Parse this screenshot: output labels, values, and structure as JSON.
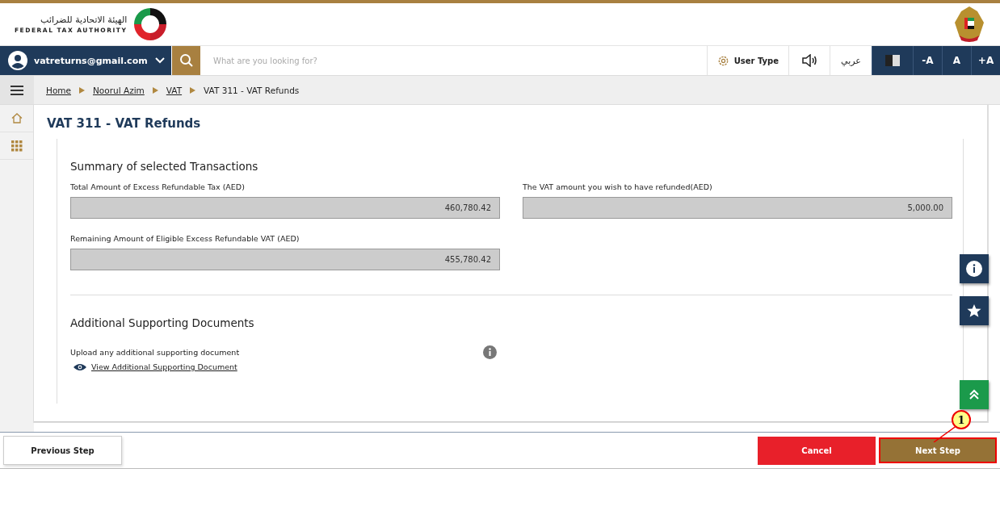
{
  "header": {
    "logo_arabic": "الهيئة الاتحادية للضرائب",
    "logo_english": "FEDERAL TAX AUTHORITY"
  },
  "nav": {
    "user": "vatreturns@gmail.com",
    "search": {
      "placeholder": "What are you looking for?"
    },
    "user_type": "User Type",
    "language": "عربي",
    "font_buttons": [
      "-A",
      "A",
      "+A"
    ]
  },
  "breadcrumb": [
    "Home",
    "Noorul Azim",
    "VAT",
    "VAT 311 - VAT Refunds"
  ],
  "page_title": "VAT 311 - VAT Refunds",
  "summary": {
    "title": "Summary of selected Transactions",
    "fields": [
      {
        "label": "Total Amount of Excess Refundable Tax (AED)",
        "value": "460,780.42"
      },
      {
        "label": "The VAT amount you wish to have refunded(AED)",
        "value": "5,000.00"
      },
      {
        "label": "Remaining Amount of Eligible Excess Refundable VAT (AED)",
        "value": "455,780.42"
      }
    ]
  },
  "documents": {
    "title": "Additional Supporting Documents",
    "label": "Upload any additional supporting document",
    "link": "View Additional Supporting Document"
  },
  "footer": {
    "previous": "Previous Step",
    "cancel": "Cancel",
    "next": "Next Step"
  },
  "annotation": "1"
}
